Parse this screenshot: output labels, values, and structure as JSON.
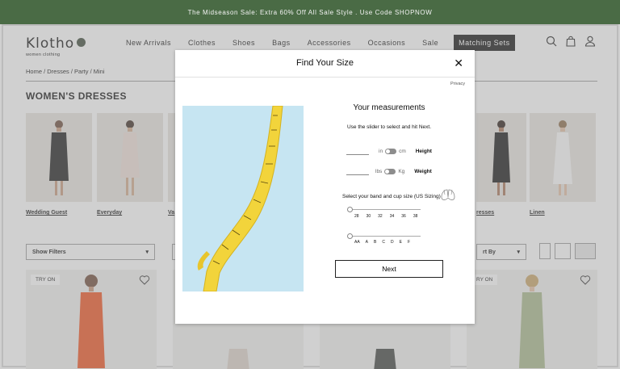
{
  "promo_banner": "The Midseason Sale: Extra 60% Off All Sale Style . Use Code SHOPNOW",
  "brand": {
    "name": "Klotho",
    "tagline": "women clothing"
  },
  "nav": {
    "items": [
      "New Arrivals",
      "Clothes",
      "Shoes",
      "Bags",
      "Accessories",
      "Occasions",
      "Sale"
    ],
    "highlight": "Matching Sets"
  },
  "header_icons": [
    "search-icon",
    "bag-icon",
    "user-icon"
  ],
  "breadcrumb": "Home / Dresses / Party / Mini",
  "page_title": "WOMEN'S DRESSES",
  "categories": [
    {
      "label": "Wedding Guest"
    },
    {
      "label": "Everyday"
    },
    {
      "label": "Va"
    },
    {
      "label": "resses"
    },
    {
      "label": "Linen"
    }
  ],
  "filters": {
    "show_filters": "Show Filters",
    "sort_by": "rt By"
  },
  "products": [
    {
      "try_on": "TRY ON"
    },
    {
      "try_on": ""
    },
    {
      "try_on": ""
    },
    {
      "try_on": "RY ON"
    }
  ],
  "modal": {
    "title": "Find Your Size",
    "close": "✕",
    "privacy": "Privacy",
    "measurements_title": "Your measurements",
    "instructions": "Use the slider to select and hit Next.",
    "height": {
      "unit_left": "in",
      "unit_right": "cm",
      "label": "Height"
    },
    "weight": {
      "unit_left": "lbs",
      "unit_right": "Kg",
      "label": "Weight"
    },
    "band_title": "Select your band and cup size (US Sizing)",
    "band_sizes": [
      "28",
      "30",
      "32",
      "34",
      "36",
      "38"
    ],
    "cup_sizes": [
      "AA",
      "A",
      "B",
      "C",
      "D",
      "E",
      "F"
    ],
    "next_label": "Next"
  },
  "colors": {
    "promo_bg": "#4a6b45",
    "tape_bg": "#c6e5f2",
    "tape_yellow": "#f2d43b"
  }
}
